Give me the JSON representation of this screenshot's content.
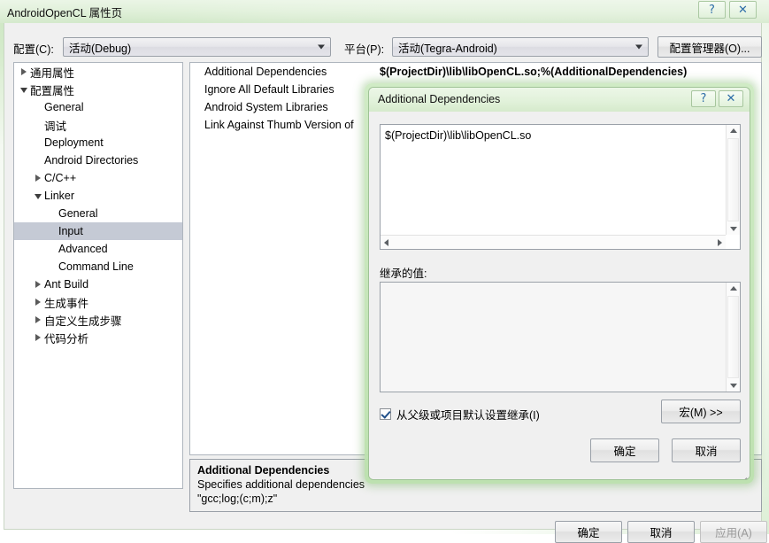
{
  "window": {
    "title": "AndroidOpenCL 属性页",
    "help_glyph": "?",
    "close_glyph": "✕"
  },
  "toolbar": {
    "config_label": "配置(C):",
    "config_value": "活动(Debug)",
    "platform_label": "平台(P):",
    "platform_value": "活动(Tegra-Android)",
    "config_manager_label": "配置管理器(O)..."
  },
  "tree": {
    "items": [
      {
        "label": "通用属性",
        "indent": 0,
        "twisty": "collapsed",
        "selected": false
      },
      {
        "label": "配置属性",
        "indent": 0,
        "twisty": "expanded",
        "selected": false
      },
      {
        "label": "General",
        "indent": 1,
        "twisty": "none",
        "selected": false
      },
      {
        "label": "调试",
        "indent": 1,
        "twisty": "none",
        "selected": false
      },
      {
        "label": "Deployment",
        "indent": 1,
        "twisty": "none",
        "selected": false
      },
      {
        "label": "Android Directories",
        "indent": 1,
        "twisty": "none",
        "selected": false
      },
      {
        "label": "C/C++",
        "indent": 1,
        "twisty": "collapsed",
        "selected": false
      },
      {
        "label": "Linker",
        "indent": 1,
        "twisty": "expanded",
        "selected": false
      },
      {
        "label": "General",
        "indent": 2,
        "twisty": "none",
        "selected": false
      },
      {
        "label": "Input",
        "indent": 2,
        "twisty": "none",
        "selected": true
      },
      {
        "label": "Advanced",
        "indent": 2,
        "twisty": "none",
        "selected": false
      },
      {
        "label": "Command Line",
        "indent": 2,
        "twisty": "none",
        "selected": false
      },
      {
        "label": "Ant Build",
        "indent": 1,
        "twisty": "collapsed",
        "selected": false
      },
      {
        "label": "生成事件",
        "indent": 1,
        "twisty": "collapsed",
        "selected": false
      },
      {
        "label": "自定义生成步骤",
        "indent": 1,
        "twisty": "collapsed",
        "selected": false
      },
      {
        "label": "代码分析",
        "indent": 1,
        "twisty": "collapsed",
        "selected": false
      }
    ]
  },
  "grid": {
    "rows": [
      {
        "name": "Additional Dependencies",
        "value": "$(ProjectDir)\\lib\\libOpenCL.so;%(AdditionalDependencies)"
      },
      {
        "name": "Ignore All Default Libraries",
        "value": ""
      },
      {
        "name": "Android System Libraries",
        "value": ""
      },
      {
        "name": "Link Against Thumb Version of",
        "value": ""
      }
    ]
  },
  "description": {
    "title": "Additional Dependencies",
    "line1": "Specifies additional dependencies",
    "line2": "\"gcc;log;(c;m);z\""
  },
  "footer": {
    "ok_label": "确定",
    "cancel_label": "取消",
    "apply_label": "应用(A)"
  },
  "dialog": {
    "title": "Additional Dependencies",
    "help_glyph": "?",
    "close_glyph": "✕",
    "edit_value": "$(ProjectDir)\\lib\\libOpenCL.so",
    "inherited_label": "继承的值:",
    "inherited_value": "",
    "inherit_checkbox_label": "从父级或项目默认设置继承(I)",
    "inherit_checked": true,
    "macro_label": "宏(M) >>",
    "ok_label": "确定",
    "cancel_label": "取消"
  },
  "colors": {
    "aero_green": "#bae0ac",
    "selection": "#c5cad5",
    "window_bg": "#f0f0f0"
  }
}
